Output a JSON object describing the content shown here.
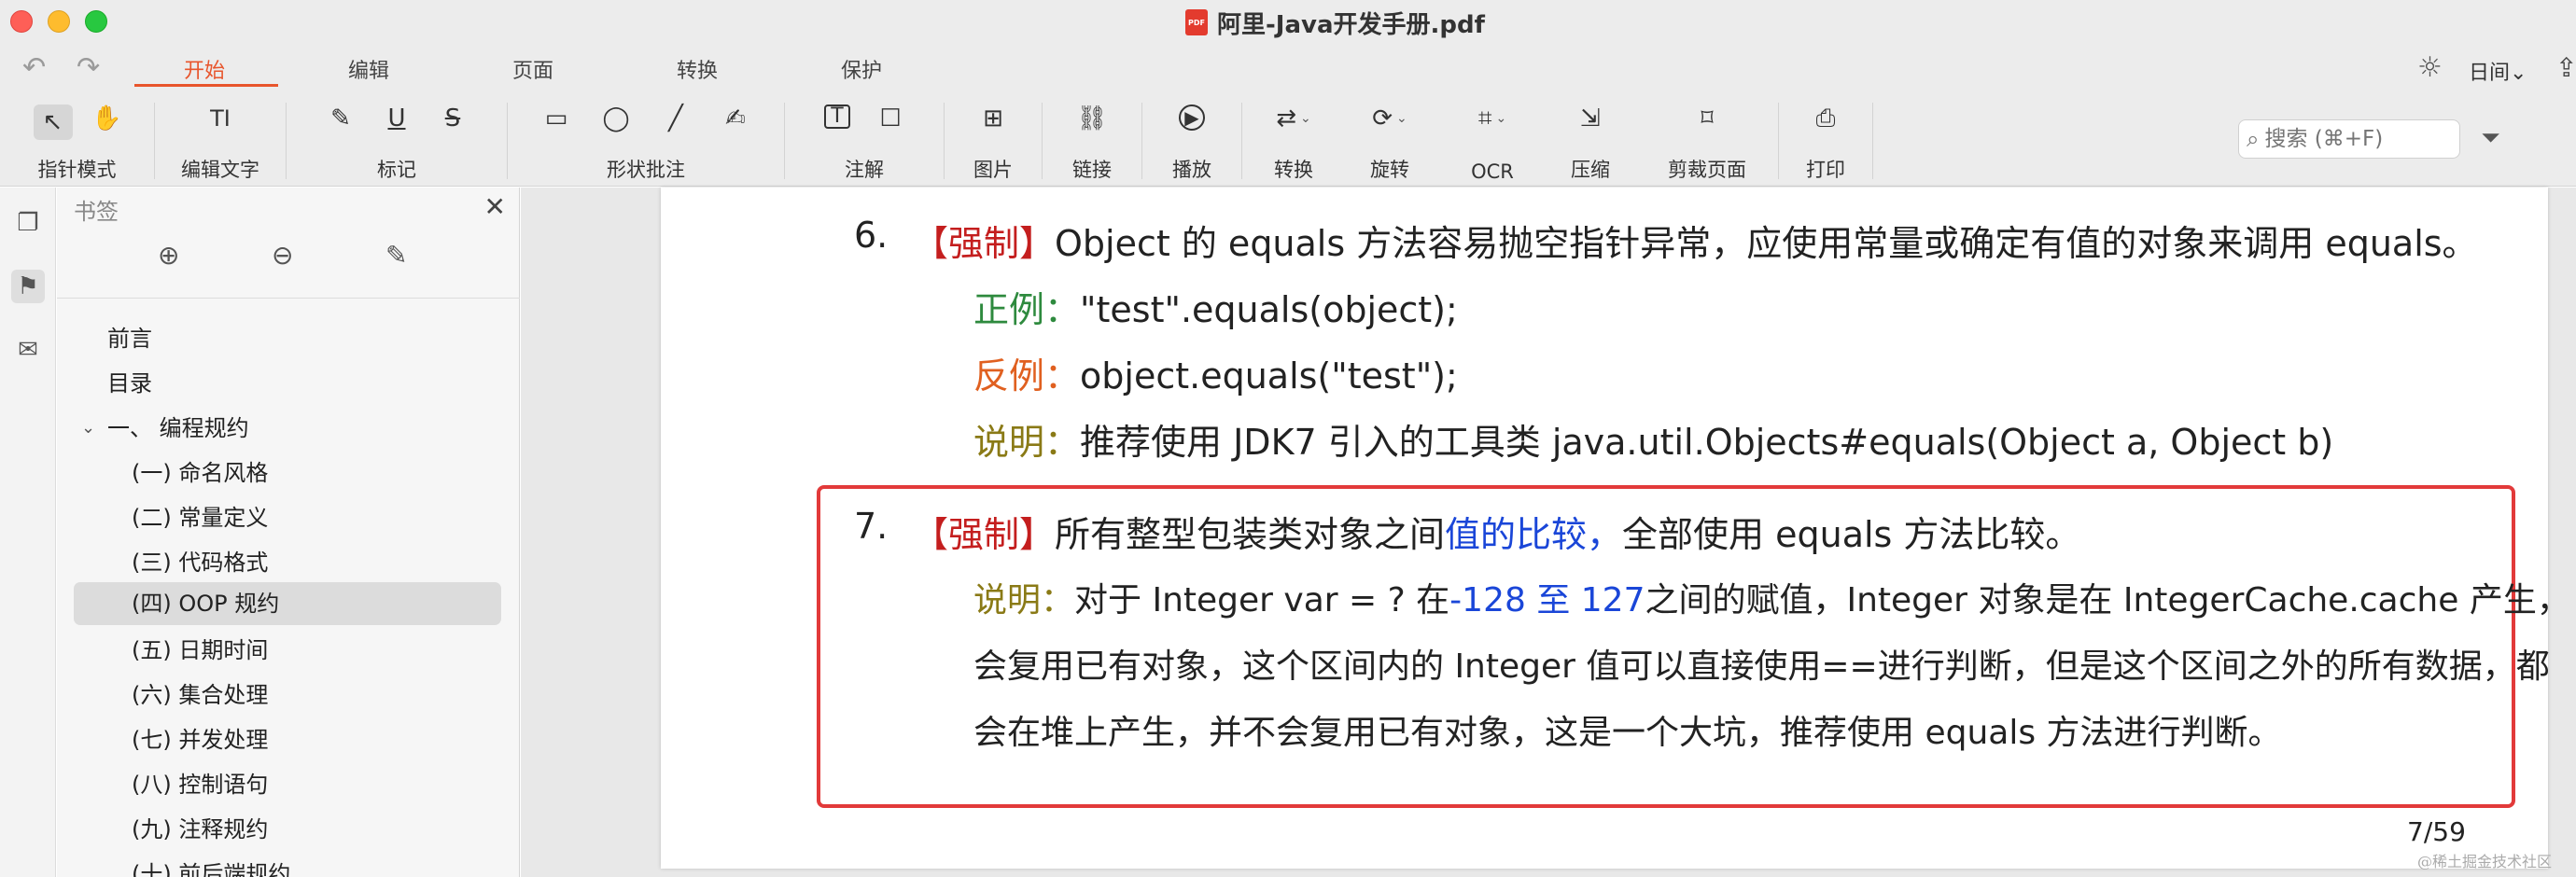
{
  "window": {
    "title": "阿里-Java开发手册.pdf",
    "file_icon": "PDF"
  },
  "history": {
    "undo_icon": "↶",
    "redo_icon": "↷"
  },
  "tabs": [
    {
      "label": "开始",
      "active": true
    },
    {
      "label": "编辑"
    },
    {
      "label": "页面"
    },
    {
      "label": "转换"
    },
    {
      "label": "保护"
    }
  ],
  "top_right": {
    "brightness_icon": "☼",
    "view_mode": "日间",
    "view_caret": "⌄",
    "share_icon": "⇪"
  },
  "toolbar": {
    "pointer": {
      "label": "指针模式",
      "icons": [
        "↖",
        "✋"
      ]
    },
    "edit_text": {
      "label": "编辑文字",
      "icons": [
        "TI"
      ]
    },
    "markup": {
      "label": "标记",
      "icons": [
        "✎",
        "U",
        "S"
      ]
    },
    "shapes": {
      "label": "形状批注",
      "icons": [
        "▭",
        "◯",
        "╱",
        "✍"
      ]
    },
    "annotation": {
      "label": "注解",
      "icons": [
        "T",
        "☐"
      ]
    },
    "image": {
      "label": "图片",
      "icons": [
        "⊞"
      ]
    },
    "link": {
      "label": "链接",
      "icons": [
        "⛓"
      ]
    },
    "play": {
      "label": "播放",
      "icons": [
        "▶"
      ]
    },
    "convert": {
      "label": "转换",
      "icons": [
        "⇄"
      ]
    },
    "rotate": {
      "label": "旋转",
      "icons": [
        "⟳"
      ]
    },
    "ocr": {
      "label": "OCR",
      "icons": [
        "⌗"
      ]
    },
    "compress": {
      "label": "压缩",
      "icons": [
        "⇲"
      ]
    },
    "crop": {
      "label": "剪裁页面",
      "icons": [
        "⌑"
      ]
    },
    "print": {
      "label": "打印",
      "icons": [
        "⎙"
      ]
    }
  },
  "search": {
    "placeholder": "搜索 (⌘+F)",
    "icon": "⌕",
    "filter_icon": "⏷"
  },
  "rail": {
    "pages_icon": "❐",
    "bookmarks_icon": "⚑",
    "comments_icon": "✉"
  },
  "bookmarks": {
    "title": "书签",
    "close_icon": "✕",
    "action_icons": [
      "⊕",
      "⊖",
      "✎"
    ],
    "items": [
      {
        "label": "前言",
        "level": 1
      },
      {
        "label": "目录",
        "level": 1
      },
      {
        "label": "一、 编程规约",
        "level": 1,
        "expanded": true
      },
      {
        "label": "(一) 命名风格",
        "level": 2
      },
      {
        "label": "(二) 常量定义",
        "level": 2
      },
      {
        "label": "(三) 代码格式",
        "level": 2
      },
      {
        "label": "(四) OOP 规约",
        "level": 2,
        "selected": true
      },
      {
        "label": "(五) 日期时间",
        "level": 2
      },
      {
        "label": "(六) 集合处理",
        "level": 2
      },
      {
        "label": "(七) 并发处理",
        "level": 2
      },
      {
        "label": "(八) 控制语句",
        "level": 2
      },
      {
        "label": "(九) 注释规约",
        "level": 2
      },
      {
        "label": "(十) 前后端规约",
        "level": 2
      }
    ]
  },
  "document": {
    "rule6": {
      "num": "6.",
      "tag": "【强制】",
      "text": "Object 的 equals 方法容易抛空指针异常，应使用常量或确定有值的对象来调用 equals。",
      "good_label": "正例：",
      "good_text": "\"test\".equals(object);",
      "bad_label": "反例：",
      "bad_text": "object.equals(\"test\");",
      "note_label": "说明：",
      "note_text": "推荐使用 JDK7 引入的工具类 java.util.Objects#equals(Object a, Object b)"
    },
    "rule7": {
      "num": "7.",
      "tag": "【强制】",
      "text_a": "所有整型包装类对象之间",
      "text_b": "值的比较，",
      "text_c": "全部使用 equals 方法比较。",
      "note_label": "说明：",
      "note_a": "对于 Integer var = ? 在",
      "note_b": "-128 至 127",
      "note_c": "之间的赋值，Integer 对象是在 IntegerCache.cache 产生，",
      "line2": "会复用已有对象，这个区间内的 Integer 值可以直接使用==进行判断，但是这个区间之外的所有数据，都",
      "line3": "会在堆上产生，并不会复用已有对象，这是一个大坑，推荐使用 equals 方法进行判断。"
    },
    "page_number": "7/59"
  },
  "watermark": "@稀土掘金技术社区"
}
